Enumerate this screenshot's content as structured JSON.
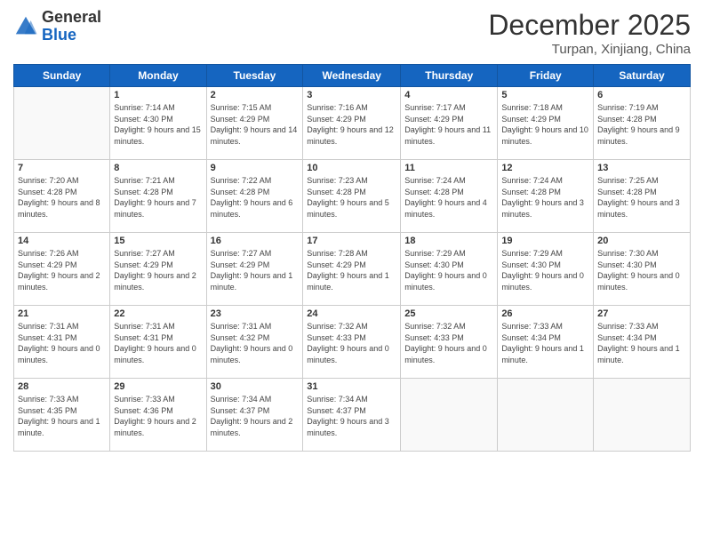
{
  "header": {
    "logo": {
      "general": "General",
      "blue": "Blue"
    },
    "title": "December 2025",
    "location": "Turpan, Xinjiang, China"
  },
  "calendar": {
    "days_of_week": [
      "Sunday",
      "Monday",
      "Tuesday",
      "Wednesday",
      "Thursday",
      "Friday",
      "Saturday"
    ],
    "weeks": [
      [
        {
          "day": "",
          "sunrise": "",
          "sunset": "",
          "daylight": ""
        },
        {
          "day": "1",
          "sunrise": "7:14 AM",
          "sunset": "4:30 PM",
          "daylight": "9 hours and 15 minutes."
        },
        {
          "day": "2",
          "sunrise": "7:15 AM",
          "sunset": "4:29 PM",
          "daylight": "9 hours and 14 minutes."
        },
        {
          "day": "3",
          "sunrise": "7:16 AM",
          "sunset": "4:29 PM",
          "daylight": "9 hours and 12 minutes."
        },
        {
          "day": "4",
          "sunrise": "7:17 AM",
          "sunset": "4:29 PM",
          "daylight": "9 hours and 11 minutes."
        },
        {
          "day": "5",
          "sunrise": "7:18 AM",
          "sunset": "4:29 PM",
          "daylight": "9 hours and 10 minutes."
        },
        {
          "day": "6",
          "sunrise": "7:19 AM",
          "sunset": "4:28 PM",
          "daylight": "9 hours and 9 minutes."
        }
      ],
      [
        {
          "day": "7",
          "sunrise": "7:20 AM",
          "sunset": "4:28 PM",
          "daylight": "9 hours and 8 minutes."
        },
        {
          "day": "8",
          "sunrise": "7:21 AM",
          "sunset": "4:28 PM",
          "daylight": "9 hours and 7 minutes."
        },
        {
          "day": "9",
          "sunrise": "7:22 AM",
          "sunset": "4:28 PM",
          "daylight": "9 hours and 6 minutes."
        },
        {
          "day": "10",
          "sunrise": "7:23 AM",
          "sunset": "4:28 PM",
          "daylight": "9 hours and 5 minutes."
        },
        {
          "day": "11",
          "sunrise": "7:24 AM",
          "sunset": "4:28 PM",
          "daylight": "9 hours and 4 minutes."
        },
        {
          "day": "12",
          "sunrise": "7:24 AM",
          "sunset": "4:28 PM",
          "daylight": "9 hours and 3 minutes."
        },
        {
          "day": "13",
          "sunrise": "7:25 AM",
          "sunset": "4:28 PM",
          "daylight": "9 hours and 3 minutes."
        }
      ],
      [
        {
          "day": "14",
          "sunrise": "7:26 AM",
          "sunset": "4:29 PM",
          "daylight": "9 hours and 2 minutes."
        },
        {
          "day": "15",
          "sunrise": "7:27 AM",
          "sunset": "4:29 PM",
          "daylight": "9 hours and 2 minutes."
        },
        {
          "day": "16",
          "sunrise": "7:27 AM",
          "sunset": "4:29 PM",
          "daylight": "9 hours and 1 minute."
        },
        {
          "day": "17",
          "sunrise": "7:28 AM",
          "sunset": "4:29 PM",
          "daylight": "9 hours and 1 minute."
        },
        {
          "day": "18",
          "sunrise": "7:29 AM",
          "sunset": "4:30 PM",
          "daylight": "9 hours and 0 minutes."
        },
        {
          "day": "19",
          "sunrise": "7:29 AM",
          "sunset": "4:30 PM",
          "daylight": "9 hours and 0 minutes."
        },
        {
          "day": "20",
          "sunrise": "7:30 AM",
          "sunset": "4:30 PM",
          "daylight": "9 hours and 0 minutes."
        }
      ],
      [
        {
          "day": "21",
          "sunrise": "7:31 AM",
          "sunset": "4:31 PM",
          "daylight": "9 hours and 0 minutes."
        },
        {
          "day": "22",
          "sunrise": "7:31 AM",
          "sunset": "4:31 PM",
          "daylight": "9 hours and 0 minutes."
        },
        {
          "day": "23",
          "sunrise": "7:31 AM",
          "sunset": "4:32 PM",
          "daylight": "9 hours and 0 minutes."
        },
        {
          "day": "24",
          "sunrise": "7:32 AM",
          "sunset": "4:33 PM",
          "daylight": "9 hours and 0 minutes."
        },
        {
          "day": "25",
          "sunrise": "7:32 AM",
          "sunset": "4:33 PM",
          "daylight": "9 hours and 0 minutes."
        },
        {
          "day": "26",
          "sunrise": "7:33 AM",
          "sunset": "4:34 PM",
          "daylight": "9 hours and 1 minute."
        },
        {
          "day": "27",
          "sunrise": "7:33 AM",
          "sunset": "4:34 PM",
          "daylight": "9 hours and 1 minute."
        }
      ],
      [
        {
          "day": "28",
          "sunrise": "7:33 AM",
          "sunset": "4:35 PM",
          "daylight": "9 hours and 1 minute."
        },
        {
          "day": "29",
          "sunrise": "7:33 AM",
          "sunset": "4:36 PM",
          "daylight": "9 hours and 2 minutes."
        },
        {
          "day": "30",
          "sunrise": "7:34 AM",
          "sunset": "4:37 PM",
          "daylight": "9 hours and 2 minutes."
        },
        {
          "day": "31",
          "sunrise": "7:34 AM",
          "sunset": "4:37 PM",
          "daylight": "9 hours and 3 minutes."
        },
        {
          "day": "",
          "sunrise": "",
          "sunset": "",
          "daylight": ""
        },
        {
          "day": "",
          "sunrise": "",
          "sunset": "",
          "daylight": ""
        },
        {
          "day": "",
          "sunrise": "",
          "sunset": "",
          "daylight": ""
        }
      ]
    ]
  }
}
